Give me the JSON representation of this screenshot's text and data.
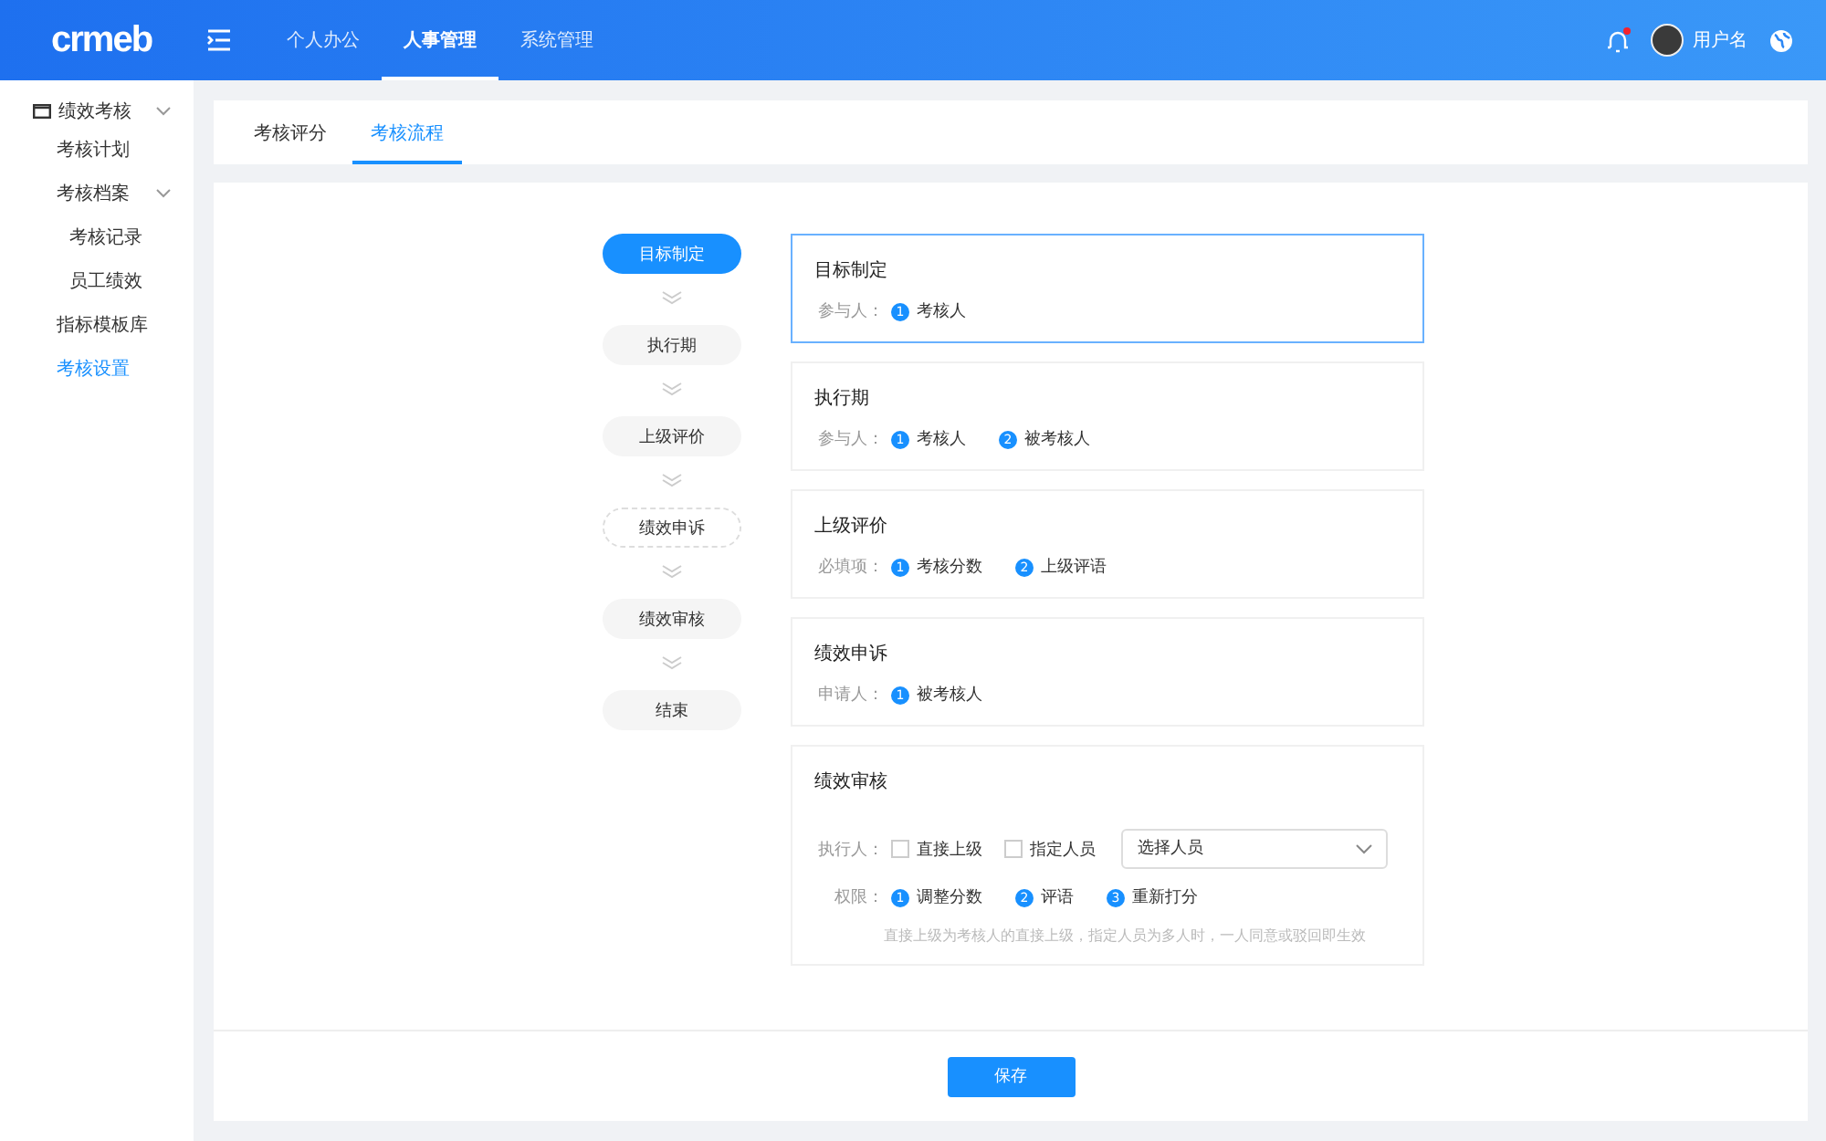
{
  "header": {
    "logo": "crmeb",
    "nav": [
      {
        "label": "个人办公",
        "selected": false
      },
      {
        "label": "人事管理",
        "selected": true
      },
      {
        "label": "系统管理",
        "selected": false
      }
    ],
    "notification": true,
    "user": "用户名"
  },
  "sidebar": {
    "group": {
      "label": "绩效考核",
      "expanded": true
    },
    "items": [
      {
        "label": "考核计划",
        "selected": false
      },
      {
        "label": "考核档案",
        "selected": false,
        "expanded": true,
        "children": [
          {
            "label": "考核记录",
            "selected": false
          },
          {
            "label": "员工绩效",
            "selected": false
          }
        ]
      },
      {
        "label": "指标模板库",
        "selected": false
      },
      {
        "label": "考核设置",
        "selected": true
      }
    ]
  },
  "tabs": [
    {
      "label": "考核评分",
      "selected": false
    },
    {
      "label": "考核流程",
      "selected": true
    }
  ],
  "steps": [
    {
      "label": "目标制定",
      "selected": true,
      "optional": false
    },
    {
      "label": "执行期",
      "selected": false,
      "optional": false
    },
    {
      "label": "上级评价",
      "selected": false,
      "optional": false
    },
    {
      "label": "绩效申诉",
      "selected": false,
      "optional": true
    },
    {
      "label": "绩效审核",
      "selected": false,
      "optional": false
    },
    {
      "label": "结束",
      "selected": false,
      "optional": false
    }
  ],
  "cards": [
    {
      "title": "目标制定",
      "selected": true,
      "rows": [
        {
          "kind": "list",
          "label": "参与人：",
          "items": [
            {
              "num": "1",
              "text": "考核人"
            }
          ]
        }
      ]
    },
    {
      "title": "执行期",
      "selected": false,
      "rows": [
        {
          "kind": "list",
          "label": "参与人：",
          "items": [
            {
              "num": "1",
              "text": "考核人"
            },
            {
              "num": "2",
              "text": "被考核人"
            }
          ]
        }
      ]
    },
    {
      "title": "上级评价",
      "selected": false,
      "rows": [
        {
          "kind": "list",
          "label": "必填项：",
          "items": [
            {
              "num": "1",
              "text": "考核分数"
            },
            {
              "num": "2",
              "text": "上级评语"
            }
          ]
        }
      ]
    },
    {
      "title": "绩效申诉",
      "selected": false,
      "rows": [
        {
          "kind": "list",
          "label": "申请人：",
          "items": [
            {
              "num": "1",
              "text": "被考核人"
            }
          ]
        }
      ]
    },
    {
      "title": "绩效审核",
      "selected": false,
      "rows": [
        {
          "kind": "checks",
          "label": "执行人：",
          "options": [
            {
              "text": "直接上级",
              "checked": false
            },
            {
              "text": "指定人员",
              "checked": false
            }
          ],
          "select": {
            "placeholder": "选择人员"
          }
        },
        {
          "kind": "list",
          "label": "权限：",
          "items": [
            {
              "num": "1",
              "text": "调整分数"
            },
            {
              "num": "2",
              "text": "评语"
            },
            {
              "num": "3",
              "text": "重新打分"
            }
          ]
        },
        {
          "kind": "hint",
          "text": "直接上级为考核人的直接上级，指定人员为多人时，一人同意或驳回即生效"
        }
      ]
    }
  ],
  "save_button": "保存"
}
